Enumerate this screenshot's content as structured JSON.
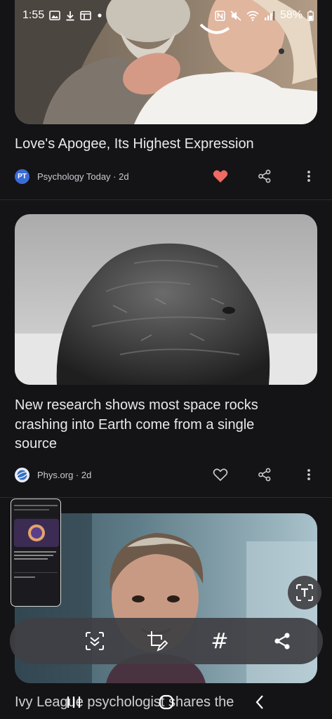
{
  "status_bar": {
    "time": "1:55",
    "battery_percent": "58%"
  },
  "articles": [
    {
      "title": "Love's Apogee, Its Highest Expression",
      "source": "Psychology Today · 2d",
      "source_logo_text": "PT",
      "liked": true
    },
    {
      "title": "New research shows most space rocks crashing into Earth come from a single source",
      "source": "Phys.org · 2d",
      "liked": false
    },
    {
      "title": "Ivy League psychologist shares the"
    }
  ],
  "colors": {
    "background": "#141417",
    "heart_liked": "#ee6a62",
    "pt_logo": "#3b6bd6"
  },
  "toolbar": {
    "buttons": [
      "scroll-capture",
      "crop-edit",
      "tag",
      "share"
    ],
    "tag_glyph": "#"
  }
}
